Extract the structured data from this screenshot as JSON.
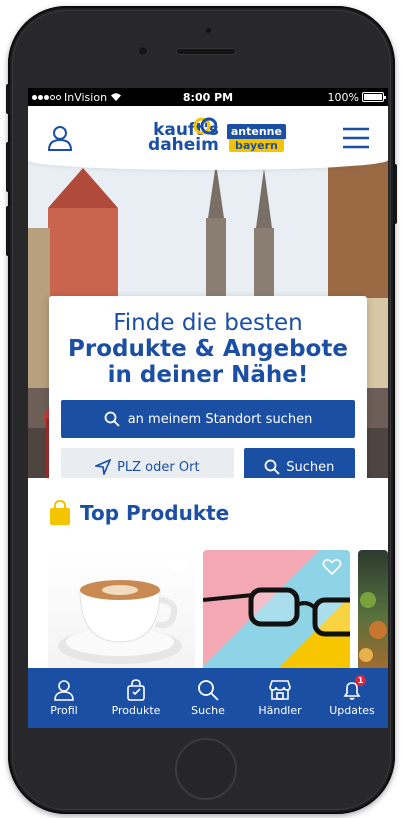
{
  "status_bar": {
    "carrier": "InVision",
    "time": "8:00 PM",
    "battery": "100%"
  },
  "header": {
    "logo_line1": "kauft's",
    "logo_line2": "daheim",
    "partner_line1": "antenne",
    "partner_line2": "bayern"
  },
  "hero": {
    "headline_line1": "Finde die besten",
    "headline_line2": "Produkte & Angebote",
    "headline_line3": "in deiner Nähe!",
    "location_button_label": "an meinem Standort suchen",
    "zip_placeholder": "PLZ oder Ort",
    "search_button_label": "Suchen"
  },
  "top_products": {
    "title": "Top Produkte",
    "items": [
      {
        "image": "coffee-cup",
        "favorite": true
      },
      {
        "image": "glasses",
        "favorite": false
      },
      {
        "image": "food",
        "favorite": false
      }
    ]
  },
  "tab_bar": {
    "items": [
      {
        "label": "Profil",
        "icon": "user-icon"
      },
      {
        "label": "Produkte",
        "icon": "bag-icon"
      },
      {
        "label": "Suche",
        "icon": "search-icon"
      },
      {
        "label": "Händler",
        "icon": "store-icon"
      },
      {
        "label": "Updates",
        "icon": "bell-icon",
        "badge": "1"
      }
    ]
  },
  "colors": {
    "brand_blue": "#1b4fa3",
    "brand_yellow": "#f5c400",
    "badge_red": "#e3203a"
  }
}
